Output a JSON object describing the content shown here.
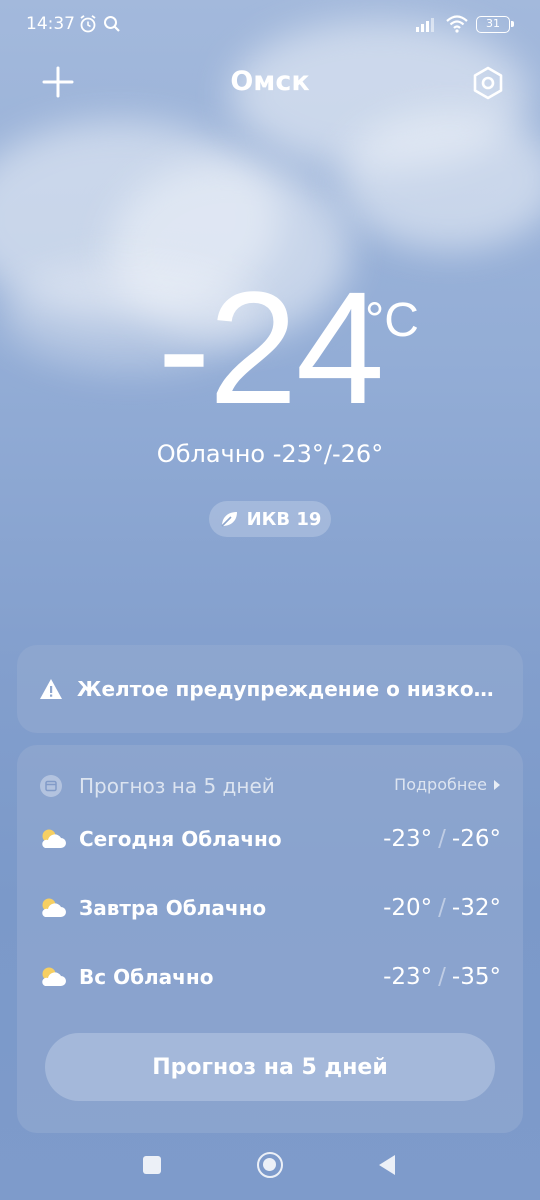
{
  "status_bar": {
    "time": "14:37",
    "battery": "31",
    "icons": [
      "alarm-icon",
      "search-icon",
      "signal-icon",
      "wifi-icon",
      "battery-icon"
    ]
  },
  "header": {
    "city": "Омск",
    "add_icon": "plus-icon",
    "settings_icon": "settings-hexagon-icon"
  },
  "current": {
    "temperature": "-24",
    "unit": "°C",
    "summary": "Облачно  -23°/-26°",
    "aqi_label": "ИКВ 19",
    "aqi_icon": "leaf-icon"
  },
  "warning": {
    "text": "Желтое предупреждение о низкой те...",
    "icon": "warning-triangle-icon"
  },
  "forecast": {
    "title": "Прогноз на 5 дней",
    "more_label": "Подробнее",
    "days": [
      {
        "label": "Сегодня  Облачно",
        "high": "-23°",
        "low": "-26°",
        "icon": "partly-cloudy-icon"
      },
      {
        "label": "Завтра  Облачно",
        "high": "-20°",
        "low": "-32°",
        "icon": "partly-cloudy-icon"
      },
      {
        "label": "Вс  Облачно",
        "high": "-23°",
        "low": "-35°",
        "icon": "partly-cloudy-icon"
      }
    ],
    "button_label": "Прогноз на 5 дней"
  },
  "colors": {
    "sky_top": "#a3b9dc",
    "sky_bottom": "#7e9bcb",
    "sun": "#f6cf62"
  }
}
